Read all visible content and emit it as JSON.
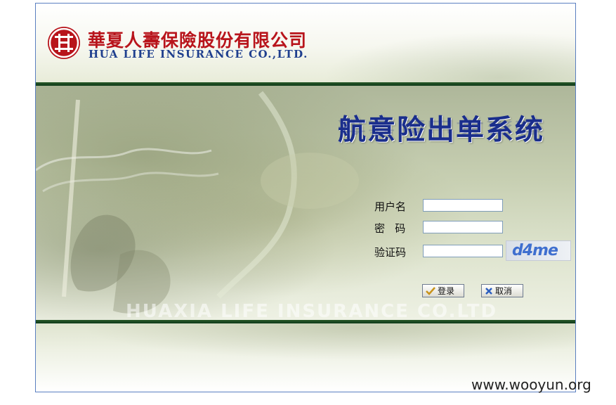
{
  "header": {
    "company_cn": "華夏人壽保險股份有限公司",
    "company_en": "HUA LIFE INSURANCE CO.,LTD."
  },
  "banner": {
    "system_title": "航意险出单系统",
    "watermark": "HUAXIA LIFE INSURANCE CO.LTD"
  },
  "login_form": {
    "username_label": "用户名",
    "username_value": "",
    "password_label": "密   码",
    "password_value": "",
    "captcha_label": "验证码",
    "captcha_value": "",
    "captcha_image_text": "d4me",
    "login_button": "登录",
    "cancel_button": "取消"
  },
  "footer": {
    "site_credit": "www.wooyun.org"
  },
  "colors": {
    "brand_red": "#b8141b",
    "brand_blue": "#1f3f8e",
    "title_blue": "#1a2e8c",
    "bar_green": "#0e3a18"
  },
  "icons": {
    "logo": "hua-xia-logo-icon",
    "login": "check-icon",
    "cancel": "close-icon"
  }
}
